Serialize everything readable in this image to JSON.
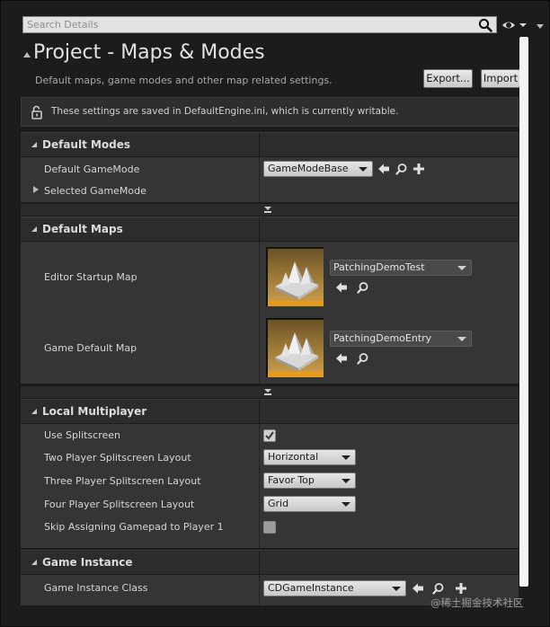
{
  "search": {
    "placeholder": "Search Details",
    "value": ""
  },
  "header": {
    "title": "Project - Maps & Modes",
    "subtitle": "Default maps, game modes and other map related settings.",
    "export_label": "Export...",
    "import_label": "Import"
  },
  "notice": {
    "text": "These settings are saved in DefaultEngine.ini, which is currently writable."
  },
  "default_modes": {
    "label": "Default Modes",
    "gamemode_label": "Default GameMode",
    "gamemode_value": "GameModeBase",
    "selected_label": "Selected GameMode"
  },
  "default_maps": {
    "label": "Default Maps",
    "editor_startup_label": "Editor Startup Map",
    "editor_startup_value": "PatchingDemoTest",
    "game_default_label": "Game Default Map",
    "game_default_value": "PatchingDemoEntry"
  },
  "local_multiplayer": {
    "label": "Local Multiplayer",
    "use_splitscreen_label": "Use Splitscreen",
    "use_splitscreen_checked": true,
    "two_player_label": "Two Player Splitscreen Layout",
    "two_player_value": "Horizontal",
    "three_player_label": "Three Player Splitscreen Layout",
    "three_player_value": "Favor Top",
    "four_player_label": "Four Player Splitscreen Layout",
    "four_player_value": "Grid",
    "skip_gamepad_label": "Skip Assigning Gamepad to Player 1",
    "skip_gamepad_checked": false
  },
  "game_instance": {
    "label": "Game Instance",
    "class_label": "Game Instance Class",
    "class_value": "CDGameInstance"
  },
  "watermark": "@稀土掘金技术社区",
  "colors": {
    "panel_bg": "#1c1c1c",
    "row_bg": "#353535",
    "category_bg": "#2c2c2c",
    "thumb_accent": "#e89a1c"
  },
  "icons": [
    "search-icon",
    "eye-icon",
    "lock-icon",
    "use-selected-arrow-icon",
    "browse-magnifier-icon",
    "add-plus-icon",
    "checkmark-icon"
  ]
}
